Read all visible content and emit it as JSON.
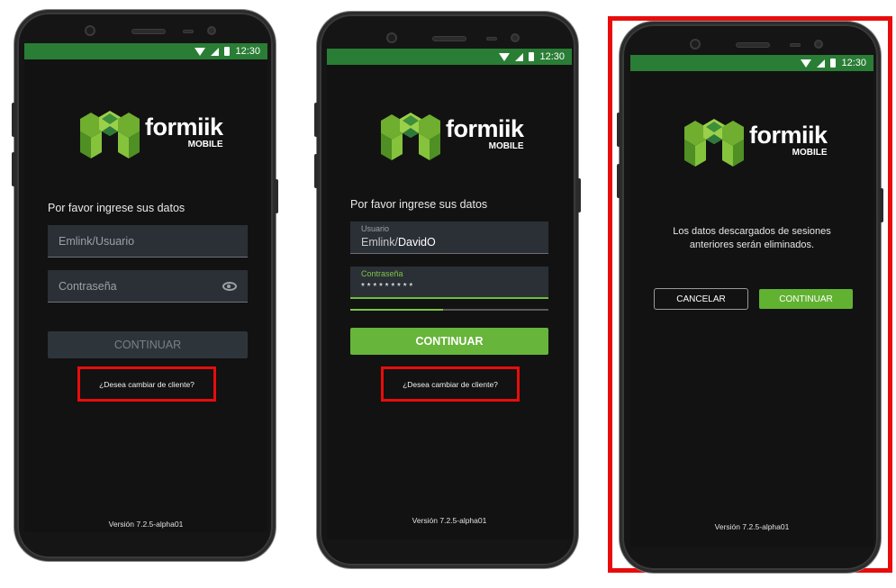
{
  "status_bar": {
    "time": "12:30"
  },
  "logo": {
    "word": "formiik",
    "sub": "MOBILE"
  },
  "screen1": {
    "prompt": "Por favor ingrese sus datos",
    "user_placeholder": "Emlink/Usuario",
    "password_placeholder": "Contraseña",
    "continue_label": "CONTINUAR",
    "change_client_link": "¿Desea cambiar de cliente?",
    "version": "Versión 7.2.5-alpha01"
  },
  "screen2": {
    "prompt": "Por favor ingrese sus datos",
    "user_label": "Usuario",
    "user_prefix": "Emlink/",
    "user_value": "DavidO",
    "password_label": "Contraseña",
    "password_value": "* * * * * * * * *",
    "progress": 0.47,
    "continue_label": "CONTINUAR",
    "change_client_link": "¿Desea cambiar de cliente?",
    "version": "Versión 7.2.5-alpha01"
  },
  "screen3": {
    "message_line1": "Los datos descargados de sesiones",
    "message_line2": "anteriores serán eliminados.",
    "cancel_label": "CANCELAR",
    "continue_label": "CONTINUAR",
    "version": "Versión 7.2.5-alpha01"
  },
  "colors": {
    "status_green": "#2a7d35",
    "accent_green": "#67b53a",
    "highlight_red": "#e80c0c"
  }
}
